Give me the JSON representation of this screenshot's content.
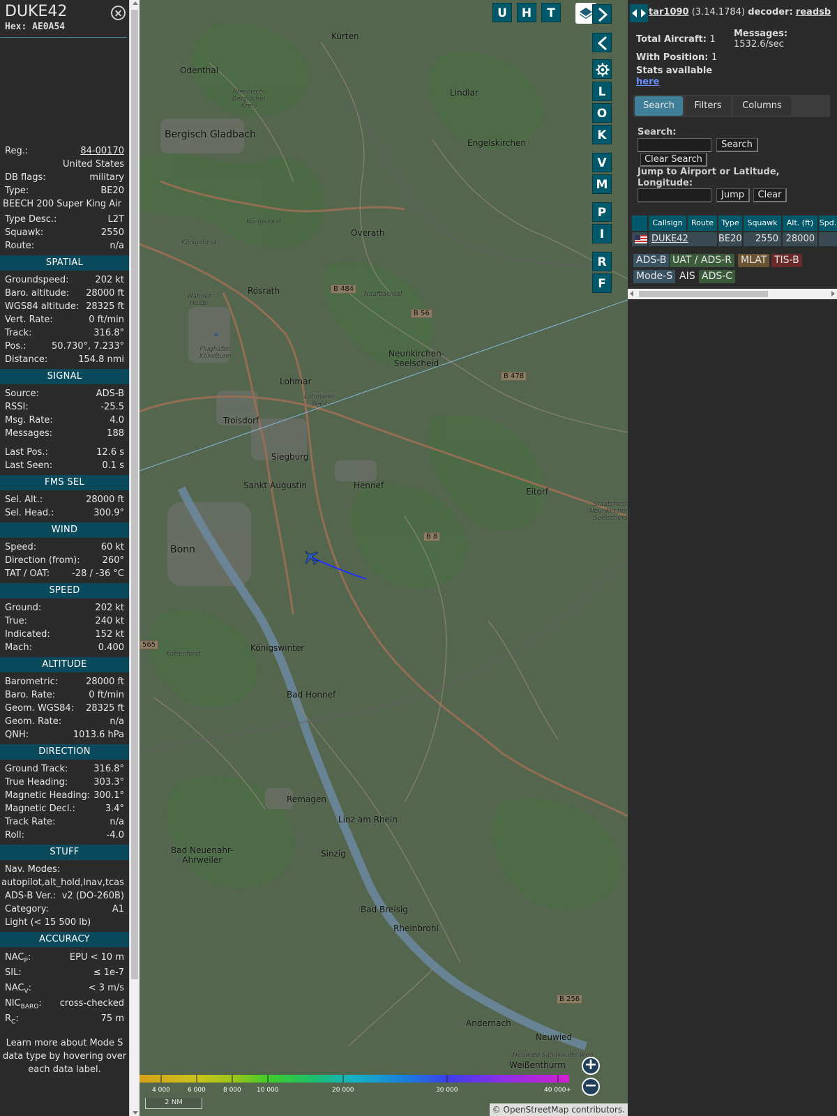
{
  "info": {
    "callsign": "DUKE42",
    "hex_label": "Hex:",
    "hex": "AE0A54",
    "details": [
      {
        "k": "Reg.:",
        "v": "84-00170"
      },
      {
        "k": "",
        "v": "United States"
      },
      {
        "k": "DB flags:",
        "v": "military"
      },
      {
        "k": "Type:",
        "v": "BE20"
      },
      {
        "k": "",
        "v": "BEECH 200 Super King Air"
      },
      {
        "k": "Type Desc.:",
        "v": "L2T"
      },
      {
        "k": "Squawk:",
        "v": "2550"
      },
      {
        "k": "Route:",
        "v": "n/a"
      }
    ],
    "sections": {
      "spatial": {
        "title": "SPATIAL",
        "rows": [
          {
            "k": "Groundspeed:",
            "v": "202 kt"
          },
          {
            "k": "Baro. altitude:",
            "v": "28000 ft"
          },
          {
            "k": "WGS84 altitude:",
            "v": "28325 ft"
          },
          {
            "k": "Vert. Rate:",
            "v": "0 ft/min"
          },
          {
            "k": "Track:",
            "v": "316.8°"
          },
          {
            "k": "Pos.:",
            "v": "50.730°, 7.233°"
          },
          {
            "k": "Distance:",
            "v": "154.8 nmi"
          }
        ]
      },
      "signal": {
        "title": "SIGNAL",
        "rows": [
          {
            "k": "Source:",
            "v": "ADS-B"
          },
          {
            "k": "RSSI:",
            "v": "-25.5"
          },
          {
            "k": "Msg. Rate:",
            "v": "4.0"
          },
          {
            "k": "Messages:",
            "v": "188"
          }
        ],
        "rows2": [
          {
            "k": "Last Pos.:",
            "v": "12.6 s"
          },
          {
            "k": "Last Seen:",
            "v": "0.1 s"
          }
        ]
      },
      "fms": {
        "title": "FMS SEL",
        "rows": [
          {
            "k": "Sel. Alt.:",
            "v": "28000 ft"
          },
          {
            "k": "Sel. Head.:",
            "v": "300.9°"
          }
        ]
      },
      "wind": {
        "title": "WIND",
        "rows": [
          {
            "k": "Speed:",
            "v": "60 kt"
          },
          {
            "k": "Direction (from):",
            "v": "260°"
          },
          {
            "k": "TAT / OAT:",
            "v": "-28 / -36 °C"
          }
        ]
      },
      "speed": {
        "title": "SPEED",
        "rows": [
          {
            "k": "Ground:",
            "v": "202 kt"
          },
          {
            "k": "True:",
            "v": "240 kt"
          },
          {
            "k": "Indicated:",
            "v": "152 kt"
          },
          {
            "k": "Mach:",
            "v": "0.400"
          }
        ]
      },
      "altitude": {
        "title": "ALTITUDE",
        "rows": [
          {
            "k": "Barometric:",
            "v": "28000 ft"
          },
          {
            "k": "Baro. Rate:",
            "v": "0 ft/min"
          },
          {
            "k": "Geom. WGS84:",
            "v": "28325 ft"
          },
          {
            "k": "Geom. Rate:",
            "v": "n/a"
          },
          {
            "k": "QNH:",
            "v": "1013.6 hPa"
          }
        ]
      },
      "direction": {
        "title": "DIRECTION",
        "rows": [
          {
            "k": "Ground Track:",
            "v": "316.8°"
          },
          {
            "k": "True Heading:",
            "v": "303.3°"
          },
          {
            "k": "Magnetic Heading:",
            "v": "300.1°"
          },
          {
            "k": "Magnetic Decl.:",
            "v": "3.4°"
          },
          {
            "k": "Track Rate:",
            "v": "n/a"
          },
          {
            "k": "Roll:",
            "v": "-4.0"
          }
        ]
      },
      "stuff": {
        "title": "STUFF",
        "nav_modes_label": "Nav. Modes:",
        "nav_modes": "autopilot,alt_hold,lnav,tcas",
        "rows": [
          {
            "k": "ADS-B Ver.:",
            "v": "v2 (DO-260B)"
          },
          {
            "k": "Category:",
            "v": "A1"
          }
        ],
        "category_desc": "Light (< 15 500 lb)"
      },
      "accuracy": {
        "title": "ACCURACY",
        "nacp_k": "NAC",
        "nacp_sub": "P",
        "nacp_v": "EPU < 10 m",
        "sil_k": "SIL:",
        "sil_v": "≤ 1e-7",
        "nacv_k": "NAC",
        "nacv_sub": "V",
        "nacv_v": "< 3 m/s",
        "nicbaro_k": "NIC",
        "nicbaro_sub": "BARO",
        "nicbaro_v": "cross-checked",
        "rc_k": "R",
        "rc_sub": "C",
        "rc_v": "75 m"
      }
    },
    "learn_more": "Learn more about Mode S data type by hovering over each data label."
  },
  "map": {
    "buttons_top": [
      "U",
      "H",
      "T"
    ],
    "buttons_side": [
      "L",
      "O",
      "K",
      "V",
      "M",
      "P",
      "I",
      "R",
      "F"
    ],
    "towns": {
      "kurten": "Kürten",
      "odenthal": "Odenthal",
      "bergisch": "Bergisch Gladbach",
      "lindlar": "Lindlar",
      "engels": "Engelskirchen",
      "rheinisch": "Rheinisch-\nBergischer\nKreis",
      "konigsforst1": "Königsforst",
      "konigsforst2": "Königsforst",
      "overath": "Overath",
      "rosrath": "Rösrath",
      "wahner": "Wahner\nHeide",
      "naafbachtal": "Naafbachtal",
      "flughafen": "Flughafen\nKöln/Bonn",
      "neunkirchen": "Neunkirchen-\nSeelscheid",
      "lohmar": "Lohmar",
      "lohmarer": "Lohmarer\nWald",
      "troisdorf": "Troisdorf",
      "siegburg": "Siegburg",
      "sanktaugustin": "Sankt Augustin",
      "hennef": "Hennef",
      "eitorf": "Eitorf",
      "staatsforst": "Staatsforst\nNeunkirchen-\nSeelscheid",
      "bonn": "Bonn",
      "kottenforst": "Kottenforst",
      "konigswinter": "Königswinter",
      "badhonnef": "Bad Honnef",
      "remagen": "Remagen",
      "linz": "Linz am Rhein",
      "badneuenahr": "Bad Neuenahr-\nAhrweiler",
      "sinzig": "Sinzig",
      "badbreisig": "Bad Breisig",
      "rheinbrohl": "Rheinbrohl",
      "andernach": "Andernach",
      "neuwied": "Neuwied",
      "neuwiedsand": "Neuwied Sandkauler Weg",
      "weissenthurm": "Weißenthurm"
    },
    "road_shields": {
      "b484": "B 484",
      "b56": "B 56",
      "b478": "B 478",
      "b8": "B 8",
      "b256": "B 256",
      "r565": "565"
    },
    "altitude_scale": [
      "4 000",
      "6 000",
      "8 000",
      "10 000",
      "20 000",
      "30 000",
      "40 000+"
    ],
    "scale_bar": "2 NM",
    "attribution": "© OpenStreetMap contributors."
  },
  "sidebar": {
    "title_prefix": "tar1090",
    "version": "(3.14.1784)",
    "decoder_label": "decoder:",
    "decoder": "readsb",
    "total_aircraft_label": "Total Aircraft:",
    "total_aircraft": "1",
    "messages_label": "Messages:",
    "messages_rate": "1532.6/sec",
    "with_position_label": "With Position:",
    "with_position": "1",
    "stats_label": "Stats available",
    "stats_link": "here",
    "tabs": [
      "Search",
      "Filters",
      "Columns"
    ],
    "search_label": "Search:",
    "search_button": "Search",
    "clear_search_button": "Clear Search",
    "jump_label": "Jump to Airport or Latitude, Longitude:",
    "jump_button": "Jump",
    "clear_button": "Clear",
    "table": {
      "headers": [
        "Callsign",
        "Route",
        "Type",
        "Squawk",
        "Alt. (ft)",
        "Spd."
      ],
      "rows": [
        {
          "callsign": "DUKE42",
          "route": "",
          "type": "BE20",
          "squawk": "2550",
          "alt": "28000"
        }
      ]
    },
    "sources": [
      {
        "label": "ADS-B",
        "color": "#3a5363"
      },
      {
        "label": "UAT / ADS-R",
        "color": "#3b5b3a"
      },
      {
        "label": "MLAT",
        "color": "#6b5230"
      },
      {
        "label": "TIS-B",
        "color": "#6b2a2a"
      },
      {
        "label": "Mode-S",
        "color": "#3a5363"
      },
      {
        "label": "AIS",
        "color": "#2b2b2b"
      },
      {
        "label": "ADS-C",
        "color": "#3b5b3a"
      }
    ]
  }
}
